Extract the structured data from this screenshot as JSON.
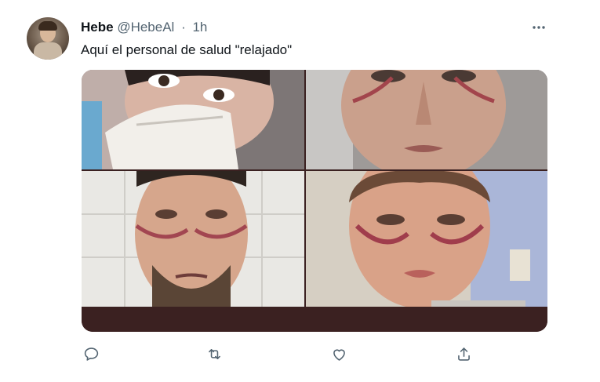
{
  "tweet": {
    "author_name": "Hebe",
    "handle": "@HebeAl",
    "separator": "·",
    "time": "1h",
    "text": "Aquí el personal de salud \"relajado\"",
    "more_icon": "more-horizontal-icon"
  },
  "media": {
    "photo_count": 4
  },
  "actions": [
    {
      "icon": "reply-icon"
    },
    {
      "icon": "retweet-icon"
    },
    {
      "icon": "like-heart-icon"
    },
    {
      "icon": "share-icon"
    }
  ],
  "colors": {
    "text": "#0f1419",
    "secondary_text": "#536471",
    "media_bar": "#3b2121"
  }
}
